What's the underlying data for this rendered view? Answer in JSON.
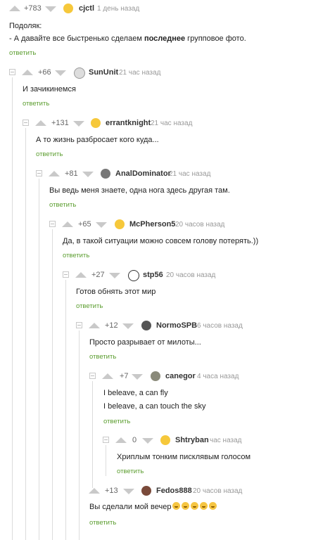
{
  "reply_label": "ответить",
  "comments": [
    {
      "rating": "+783",
      "user": "cjctl",
      "time": "1 день назад",
      "lines": [
        "Подоляк:"
      ],
      "line2_pre": "- А давайте все быстренько сделаем ",
      "line2_bold": "последнее",
      "line2_post": " групповое фото."
    },
    {
      "rating": "+66",
      "user": "SunUnit",
      "time": "21 час назад",
      "lines": [
        "И зачикинемся"
      ]
    },
    {
      "rating": "+131",
      "user": "errantknight",
      "time": "21 час назад",
      "lines": [
        "А то жизнь разбросает кого куда..."
      ]
    },
    {
      "rating": "+81",
      "user": "AnalDominator",
      "time": "21 час назад",
      "lines": [
        "Вы ведь меня знаете, одна нога здесь другая там."
      ]
    },
    {
      "rating": "+65",
      "user": "McPherson5",
      "time": "20 часов назад",
      "lines": [
        "Да, в такой ситуации можно совсем голову потерять.))"
      ]
    },
    {
      "rating": "+27",
      "user": "stp56",
      "time": "20 часов назад",
      "lines": [
        "Готов обнять этот мир"
      ]
    },
    {
      "rating": "+12",
      "user": "NormoSPB",
      "time": "6 часов назад",
      "lines": [
        "Просто разрывает от милоты..."
      ]
    },
    {
      "rating": "+7",
      "user": "canegor",
      "time": "4 часа назад",
      "lines": [
        "I beleave, a can fly",
        "I beleave, a can touch the sky"
      ]
    },
    {
      "rating": "0",
      "user": "Shtryban",
      "time": "час назад",
      "lines": [
        "Хриплым тонким писклявым голосом"
      ]
    },
    {
      "rating": "+13",
      "user": "Fedos888",
      "time": "20 часов назад",
      "lines": [
        "Вы сделали мой вечер"
      ]
    }
  ],
  "icons": {
    "upvote": "upvote-arrow-icon",
    "downvote": "downvote-arrow-icon",
    "collapse": "collapse-thread-icon"
  },
  "colors": {
    "reply_link": "#5b9d2f",
    "vote_arrow": "#c9c9c9",
    "thread_line": "#dcdcdc"
  }
}
